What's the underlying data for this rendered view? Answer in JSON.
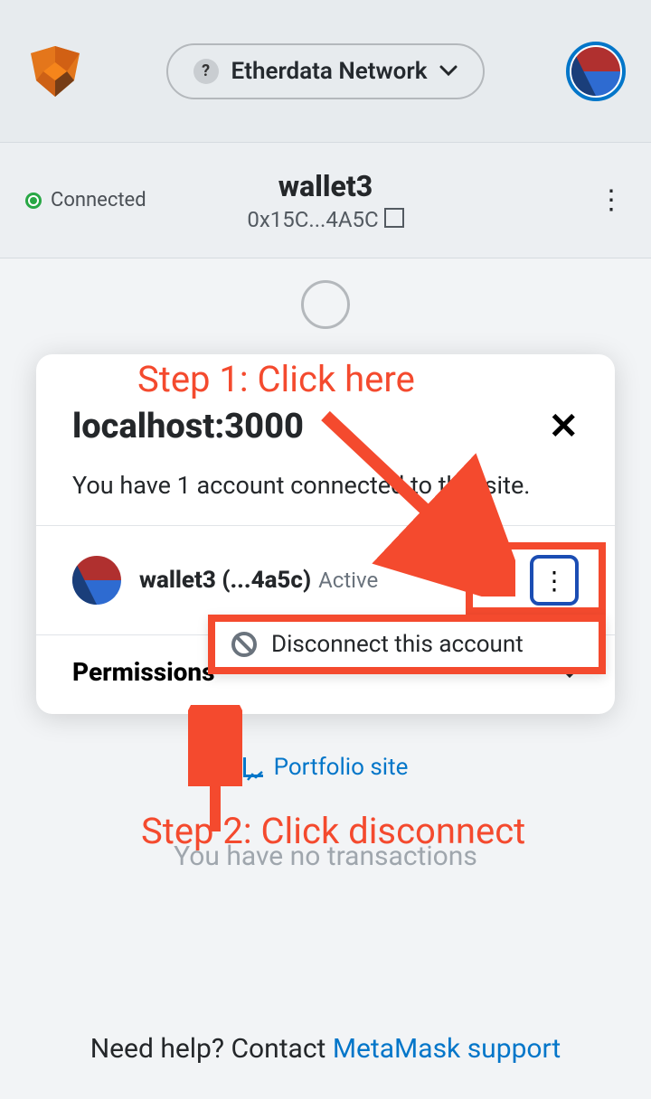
{
  "header": {
    "network_name": "Etherdata Network"
  },
  "account_bar": {
    "connected_label": "Connected",
    "wallet_name": "wallet3",
    "wallet_address": "0x15C...4A5C"
  },
  "modal": {
    "title": "localhost:3000",
    "subtitle": "You have 1 account connected to this site.",
    "row_wallet": "wallet3 (...4a5c)",
    "row_status": "Active",
    "disconnect_label": "Disconnect this account",
    "permissions_label": "Permissions"
  },
  "links": {
    "portfolio": "Portfolio site",
    "no_tx": "You have no transactions",
    "help_prefix": "Need help? Contact ",
    "help_link": "MetaMask support"
  },
  "annotations": {
    "step1": "Step 1: Click here",
    "step2": "Step 2: Click disconnect"
  }
}
